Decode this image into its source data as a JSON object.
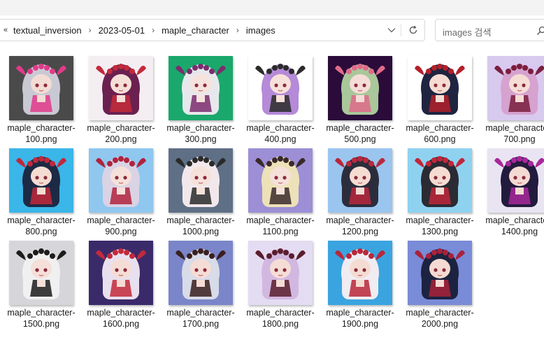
{
  "address": {
    "overflow_label": "«",
    "crumbs": [
      "textual_inversion",
      "2023-05-01",
      "maple_character",
      "images"
    ],
    "separator": "›"
  },
  "search": {
    "placeholder": "images 검색"
  },
  "files": [
    {
      "line1": "maple_character-",
      "line2": "100.png",
      "bg": "#4a4a4a",
      "hair": "#c9c9d4",
      "acc": "#e23a8a",
      "skin": "#f3dcd3"
    },
    {
      "line1": "maple_character-",
      "line2": "200.png",
      "bg": "#f4eef2",
      "hair": "#6b2150",
      "acc": "#c42a3a",
      "skin": "#f6dfd8"
    },
    {
      "line1": "maple_character-",
      "line2": "300.png",
      "bg": "#1aa86c",
      "hair": "#e8e8ec",
      "acc": "#7b2d6e",
      "skin": "#f6e3dd"
    },
    {
      "line1": "maple_character-",
      "line2": "400.png",
      "bg": "#ffffff",
      "hair": "#b58ad8",
      "acc": "#2b2b2b",
      "skin": "#f6e1da"
    },
    {
      "line1": "maple_character-",
      "line2": "500.png",
      "bg": "#2a0b3a",
      "hair": "#a9c79a",
      "acc": "#e06a8a",
      "skin": "#f4ddd6"
    },
    {
      "line1": "maple_character-",
      "line2": "600.png",
      "bg": "#ffffff",
      "hair": "#1f2440",
      "acc": "#b3202a",
      "skin": "#f5dcd3"
    },
    {
      "line1": "maple_character-",
      "line2": "700.png",
      "bg": "#d8c9ef",
      "hair": "#d6a2cf",
      "acc": "#7a1f3d",
      "skin": "#f5ddd6"
    },
    {
      "line1": "maple_character-",
      "line2": "800.png",
      "bg": "#3ab6e8",
      "hair": "#1d2a45",
      "acc": "#c2283a",
      "skin": "#f5dcd3"
    },
    {
      "line1": "maple_character-",
      "line2": "900.png",
      "bg": "#8fc7ef",
      "hair": "#d9d3e4",
      "acc": "#b0233d",
      "skin": "#f6e0da"
    },
    {
      "line1": "maple_character-",
      "line2": "1000.png",
      "bg": "#5f6f86",
      "hair": "#f2e8ec",
      "acc": "#2a2a2a",
      "skin": "#f6e1da"
    },
    {
      "line1": "maple_character-",
      "line2": "1100.png",
      "bg": "#9c8fd6",
      "hair": "#ede1b8",
      "acc": "#3a2a2a",
      "skin": "#f6e0da"
    },
    {
      "line1": "maple_character-",
      "line2": "1200.png",
      "bg": "#9ac5ef",
      "hair": "#2c2d3c",
      "acc": "#b9283c",
      "skin": "#f5dcd3"
    },
    {
      "line1": "maple_character-",
      "line2": "1300.png",
      "bg": "#8fd2f0",
      "hair": "#2b2b33",
      "acc": "#c0273a",
      "skin": "#f5dcd3"
    },
    {
      "line1": "maple_character-",
      "line2": "1400.png",
      "bg": "#e9e4f2",
      "hair": "#231b3e",
      "acc": "#a8289b",
      "skin": "#f4dad2"
    },
    {
      "line1": "maple_character-",
      "line2": "1500.png",
      "bg": "#d6d6da",
      "hair": "#f0f0f0",
      "acc": "#1c1c1c",
      "skin": "#f5dfd8"
    },
    {
      "line1": "maple_character-",
      "line2": "1600.png",
      "bg": "#3b2a6a",
      "hair": "#e8e0ee",
      "acc": "#c22a3a",
      "skin": "#f5ddd6"
    },
    {
      "line1": "maple_character-",
      "line2": "1700.png",
      "bg": "#7a86c9",
      "hair": "#d8dbe8",
      "acc": "#3b1f1f",
      "skin": "#f5dcd5"
    },
    {
      "line1": "maple_character-",
      "line2": "1800.png",
      "bg": "#e4dcf2",
      "hair": "#d2b8e0",
      "acc": "#5a1d2d",
      "skin": "#f5ddd6"
    },
    {
      "line1": "maple_character-",
      "line2": "1900.png",
      "bg": "#3aa4e0",
      "hair": "#f0ecf2",
      "acc": "#b8283a",
      "skin": "#f5dcd3"
    },
    {
      "line1": "maple_character-",
      "line2": "2000.png",
      "bg": "#7a8bd8",
      "hair": "#1c2340",
      "acc": "#a8223a",
      "skin": "#f4dad2"
    }
  ]
}
